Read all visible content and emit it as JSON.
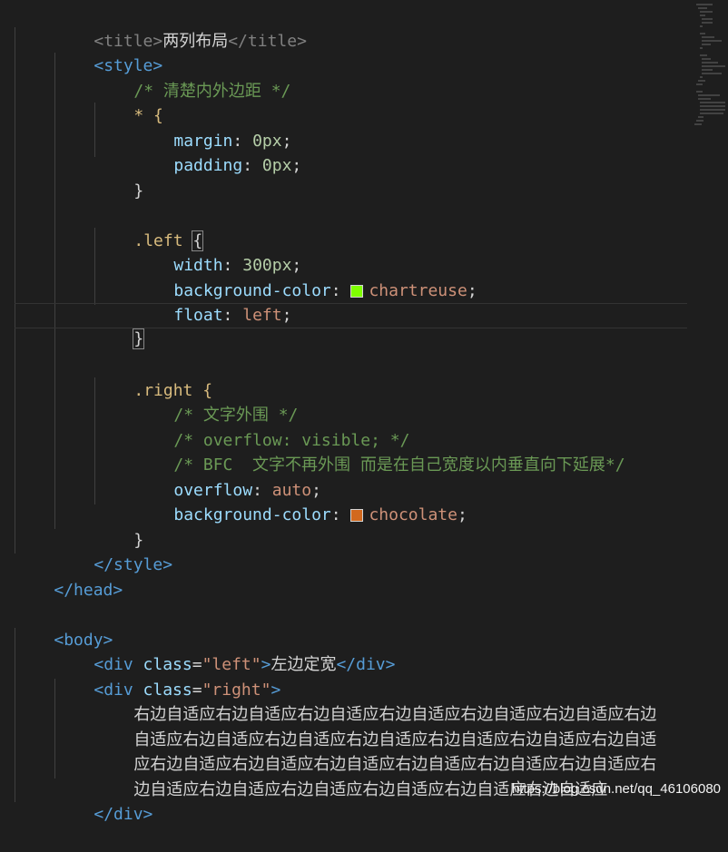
{
  "code_lines": {
    "l1": {
      "open_tag": "<title>",
      "text": "两列布局",
      "close_tag": "</title>"
    },
    "l2": {
      "tag": "<style>"
    },
    "l3": {
      "comment": "/* 清楚内外边距 */"
    },
    "l4": {
      "selector": "* {"
    },
    "l5": {
      "prop": "margin",
      "value": "0px"
    },
    "l6": {
      "prop": "padding",
      "value": "0px"
    },
    "l7": {
      "brace": "}"
    },
    "l9": {
      "selector": ".left ",
      "brace": "{"
    },
    "l10": {
      "prop": "width",
      "value": "300px"
    },
    "l11": {
      "prop": "background-color",
      "value": "chartreuse",
      "color": "#7fff00"
    },
    "l12": {
      "prop": "float",
      "value": "left"
    },
    "l13": {
      "brace": "}"
    },
    "l15": {
      "selector": ".right {"
    },
    "l16": {
      "comment": "/* 文字外围 */"
    },
    "l17": {
      "comment": "/* overflow: visible; */"
    },
    "l18": {
      "comment": "/* BFC  文字不再外围 而是在自己宽度以内垂直向下延展*/"
    },
    "l19": {
      "prop": "overflow",
      "value": "auto"
    },
    "l20": {
      "prop": "background-color",
      "value": "chocolate",
      "color": "#d2691e"
    },
    "l21": {
      "brace": "}"
    },
    "l22": {
      "tag": "</style>"
    },
    "l23": {
      "tag": "</head>"
    },
    "l25": {
      "tag": "<body>"
    },
    "l26": {
      "tag_open": "<div ",
      "attr": "class",
      "eq": "=",
      "str": "\"left\"",
      "gt": ">",
      "text": "左边定宽",
      "close": "</div>"
    },
    "l27": {
      "tag_open": "<div ",
      "attr": "class",
      "eq": "=",
      "str": "\"right\"",
      "gt": ">"
    },
    "l28": {
      "text": "右边自适应右边自适应右边自适应右边自适应右边自适应右边自适应右边"
    },
    "l29": {
      "text": "自适应右边自适应右边自适应右边自适应右边自适应右边自适应右边自适"
    },
    "l30": {
      "text": "应右边自适应右边自适应右边自适应右边自适应右边自适应右边自适应右"
    },
    "l31": {
      "text": "边自适应右边自适应右边自适应右边自适应右边自适应右边自适应"
    },
    "l32": {
      "tag": "</div>"
    }
  },
  "watermark": "https://blog.csdn.net/qq_46106080"
}
